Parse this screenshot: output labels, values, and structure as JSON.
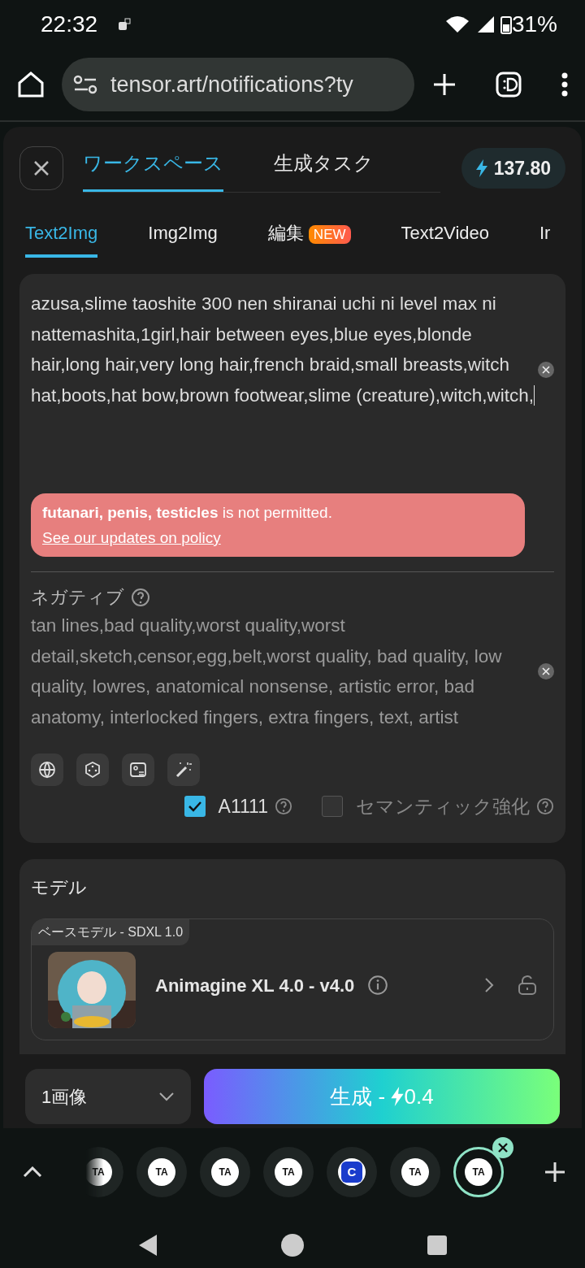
{
  "status_bar": {
    "time": "22:32",
    "battery": "31%"
  },
  "browser": {
    "url": "tensor.art/notifications?ty"
  },
  "header": {
    "tabs": [
      {
        "label": "ワークスペース",
        "selected": true
      },
      {
        "label": "生成タスク",
        "selected": false
      }
    ],
    "credits": "137.80"
  },
  "mode_tabs": [
    {
      "label": "Text2Img",
      "selected": true
    },
    {
      "label": "Img2Img",
      "selected": false
    },
    {
      "label": "編集",
      "selected": false,
      "badge": "NEW"
    },
    {
      "label": "Text2Video",
      "selected": false
    },
    {
      "label": "Ir",
      "selected": false
    }
  ],
  "prompt": {
    "value": "azusa,slime taoshite 300 nen shiranai uchi ni level max ni nattemashita,1girl,hair between eyes,blue eyes,blonde hair,long hair,very long hair,french braid,small breasts,witch hat,boots,hat bow,brown footwear,slime (creature),witch,witch,"
  },
  "toast": {
    "text": "**futanari, penis, testicles** is not permitted.",
    "link": "See our updates on policy"
  },
  "negative": {
    "label": "ネガティブ",
    "value": "tan lines,bad quality,worst quality,worst detail,sketch,censor,egg,belt,worst quality, bad quality, low quality, lowres, anatomical nonsense, artistic error, bad anatomy, interlocked fingers, extra fingers, text, artist"
  },
  "tools": [
    {
      "kind": "globe"
    },
    {
      "kind": "dice"
    },
    {
      "kind": "card"
    },
    {
      "kind": "wand"
    }
  ],
  "options": [
    {
      "label": "A1111",
      "checked": true
    },
    {
      "label": "セマンティック強化",
      "checked": false
    }
  ],
  "model": {
    "title": "モデル",
    "base": "ベースモデル - SDXL 1.0",
    "name": "Animagine XL 4.0 - v4.0"
  },
  "footer": {
    "count": "1画像",
    "generate": "生成 - ",
    "cost": "0.4"
  },
  "tab_strip": [
    {
      "kind": "ta",
      "logo": "TA",
      "selected": false,
      "faded": true
    },
    {
      "kind": "ta",
      "logo": "TA",
      "selected": false,
      "faded": false
    },
    {
      "kind": "ta",
      "logo": "TA",
      "selected": false,
      "faded": false
    },
    {
      "kind": "ta",
      "logo": "TA",
      "selected": false,
      "faded": false
    },
    {
      "kind": "c",
      "logo": "C",
      "selected": false,
      "faded": false
    },
    {
      "kind": "ta",
      "logo": "TA",
      "selected": false,
      "faded": false
    },
    {
      "kind": "ta",
      "logo": "TA",
      "selected": true,
      "faded": false
    }
  ]
}
